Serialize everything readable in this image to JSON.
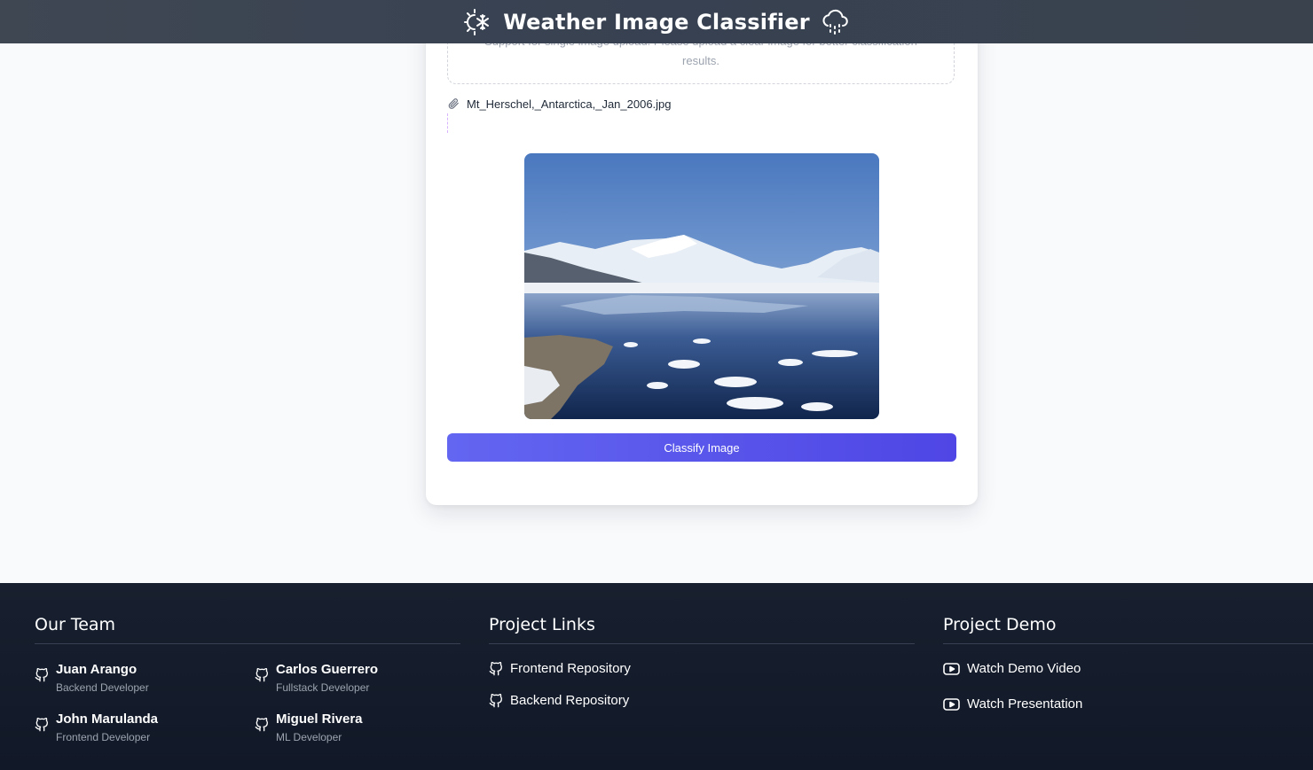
{
  "header": {
    "title": "Weather Image Classifier",
    "left_icon": "sun-snow-icon",
    "right_icon": "cloud-rain-icon"
  },
  "upload": {
    "hint": "Support for single image upload. Please upload a clear image for better classification results.",
    "file_name": "Mt_Herschel,_Antarctica,_Jan_2006.jpg",
    "file_icon": "paperclip-icon"
  },
  "preview": {
    "description_icon": "image-preview"
  },
  "actions": {
    "classify_label": "Classify Image",
    "accent_start": "#6366f1",
    "accent_end": "#4f46e5"
  },
  "footer": {
    "team_title": "Our Team",
    "members": [
      {
        "name": "Juan Arango",
        "role": "Backend Developer"
      },
      {
        "name": "Carlos Guerrero",
        "role": "Fullstack Developer"
      },
      {
        "name": "John Marulanda",
        "role": "Frontend Developer"
      },
      {
        "name": "Miguel Rivera",
        "role": "ML Developer"
      }
    ],
    "links_title": "Project Links",
    "links": [
      {
        "label": "Frontend Repository",
        "icon": "github-icon"
      },
      {
        "label": "Backend Repository",
        "icon": "github-icon"
      }
    ],
    "demo_title": "Project Demo",
    "demos": [
      {
        "label": "Watch Demo Video",
        "icon": "youtube-icon"
      },
      {
        "label": "Watch Presentation",
        "icon": "youtube-icon"
      }
    ],
    "background": "#111827"
  }
}
